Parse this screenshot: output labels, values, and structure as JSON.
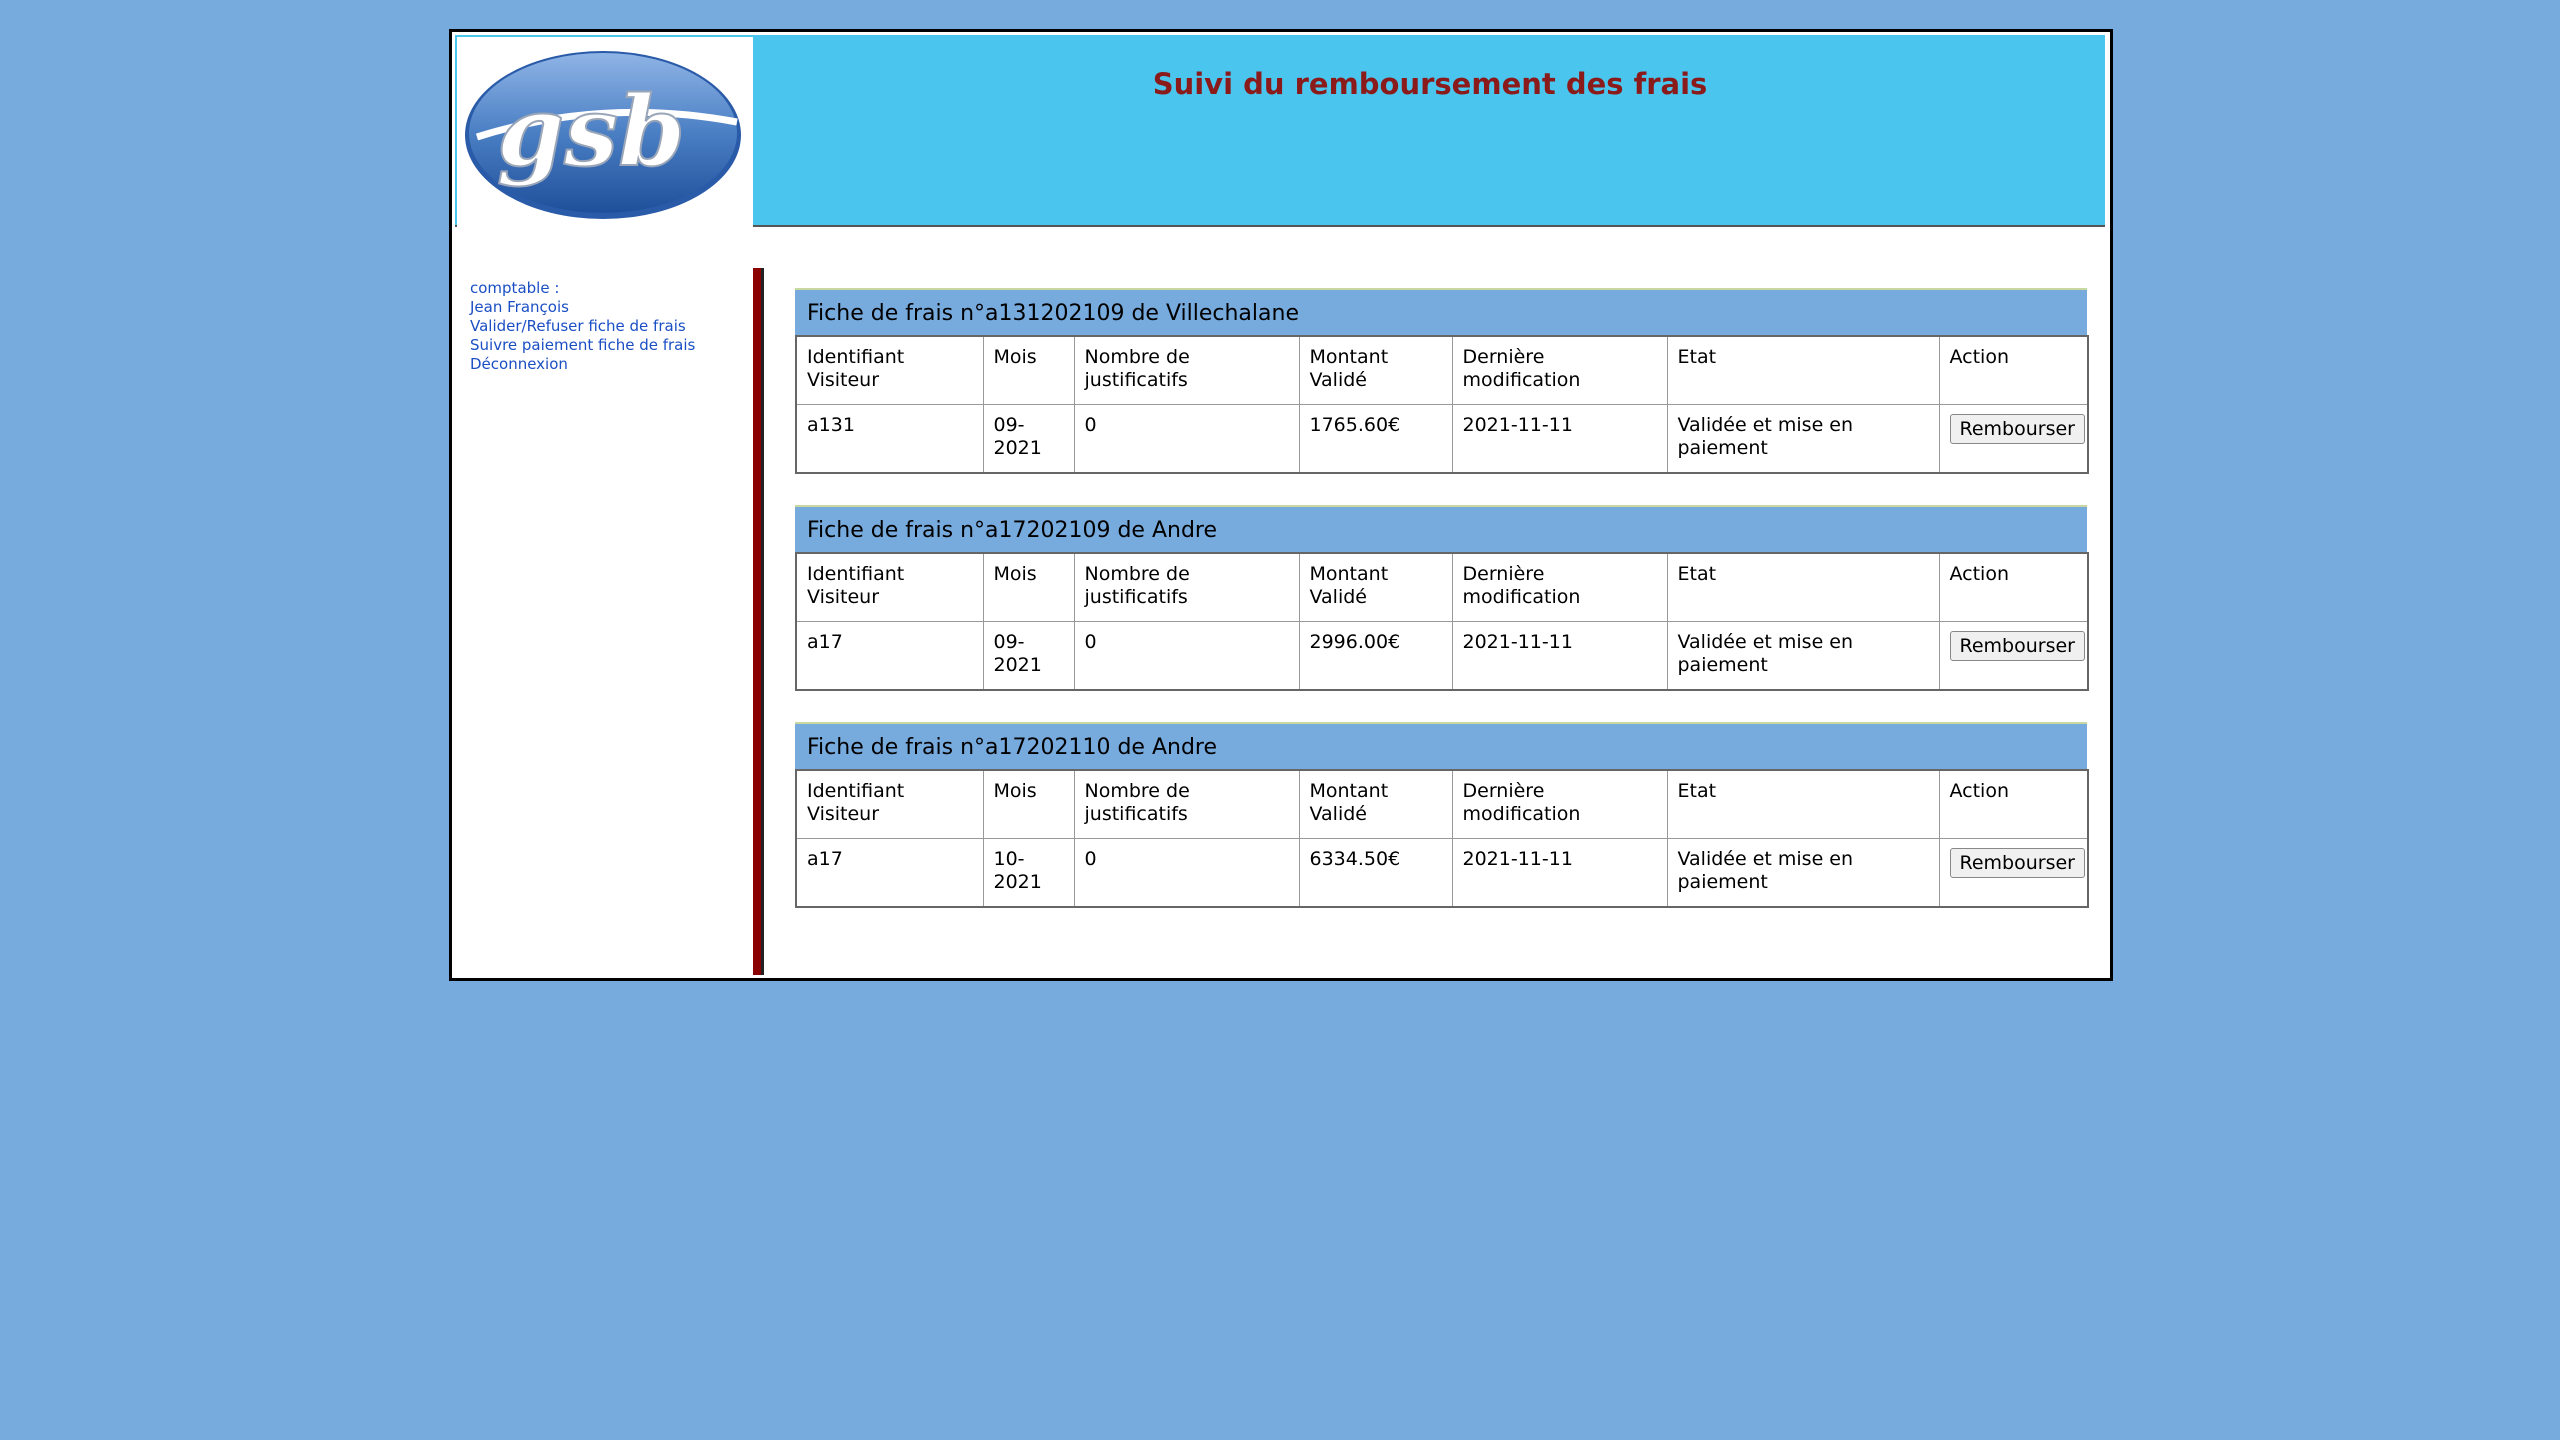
{
  "header": {
    "title": "Suivi du remboursement des frais",
    "logo_text": "gsb",
    "logo_colors": {
      "oval": "#4a7fc4",
      "oval_dark": "#1f4f9a",
      "letters": "#ffffff"
    }
  },
  "menu": {
    "role_label": "comptable :",
    "user_name": "Jean François",
    "items": [
      {
        "label": "Valider/Refuser fiche de frais"
      },
      {
        "label": "Suivre paiement fiche de frais"
      },
      {
        "label": "Déconnexion"
      }
    ]
  },
  "columns": [
    "Identifiant Visiteur",
    "Mois",
    "Nombre de justificatifs",
    "Montant Validé",
    "Dernière modification",
    "Etat",
    "Action"
  ],
  "fiches": [
    {
      "title": "Fiche de frais n°a131202109 de Villechalane",
      "row": {
        "id": "a131",
        "mois": "09-2021",
        "justificatifs": "0",
        "montant": "1765.60€",
        "modification": "2021-11-11",
        "etat": "Validée et mise en paiement",
        "action": "Rembourser"
      }
    },
    {
      "title": "Fiche de frais n°a17202109 de Andre",
      "row": {
        "id": "a17",
        "mois": "09-2021",
        "justificatifs": "0",
        "montant": "2996.00€",
        "modification": "2021-11-11",
        "etat": "Validée et mise en paiement",
        "action": "Rembourser"
      }
    },
    {
      "title": "Fiche de frais n°a17202110 de Andre",
      "row": {
        "id": "a17",
        "mois": "10-2021",
        "justificatifs": "0",
        "montant": "6334.50€",
        "modification": "2021-11-11",
        "etat": "Validée et mise en paiement",
        "action": "Rembourser"
      }
    }
  ],
  "colors": {
    "page_background": "#77aadd",
    "header_background": "#4ac6ee",
    "title_color": "#8b1a1a",
    "menu_link": "#1a4fc4",
    "divider": "#8b0000",
    "fiche_header": "#77aadd"
  }
}
